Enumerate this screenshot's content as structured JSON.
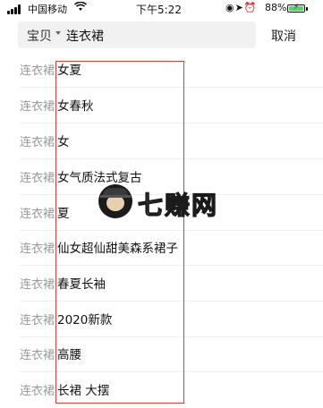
{
  "status_bar": {
    "carrier": "中国移动",
    "time": "下午5:22",
    "battery_percent": "88%",
    "battery_level": 0.88,
    "icons": [
      "signal-icon",
      "wifi-icon",
      "lock-rotation-icon",
      "location-icon",
      "alarm-icon",
      "battery-charging-icon"
    ]
  },
  "search": {
    "scope": "宝贝",
    "query": "连衣裙",
    "cancel_label": "取消"
  },
  "suggestions": [
    {
      "keyword": "连衣裙",
      "suffix": "女夏"
    },
    {
      "keyword": "连衣裙",
      "suffix": "女春秋"
    },
    {
      "keyword": "连衣裙",
      "suffix": "女"
    },
    {
      "keyword": "连衣裙",
      "suffix": "女气质法式复古"
    },
    {
      "keyword": "连衣裙",
      "suffix": "夏"
    },
    {
      "keyword": "连衣裙",
      "suffix": "仙女超仙甜美森系裙子"
    },
    {
      "keyword": "连衣裙",
      "suffix": "春夏长袖"
    },
    {
      "keyword": "连衣裙",
      "suffix": "2020新款"
    },
    {
      "keyword": "连衣裙",
      "suffix": "高腰"
    },
    {
      "keyword": "连衣裙",
      "suffix": "长裙 大摆"
    }
  ],
  "watermark": {
    "text": "七赚网"
  },
  "colors": {
    "highlight_box": "#e03a3a",
    "keyword_gray": "#999999",
    "battery_green": "#4cd964"
  }
}
